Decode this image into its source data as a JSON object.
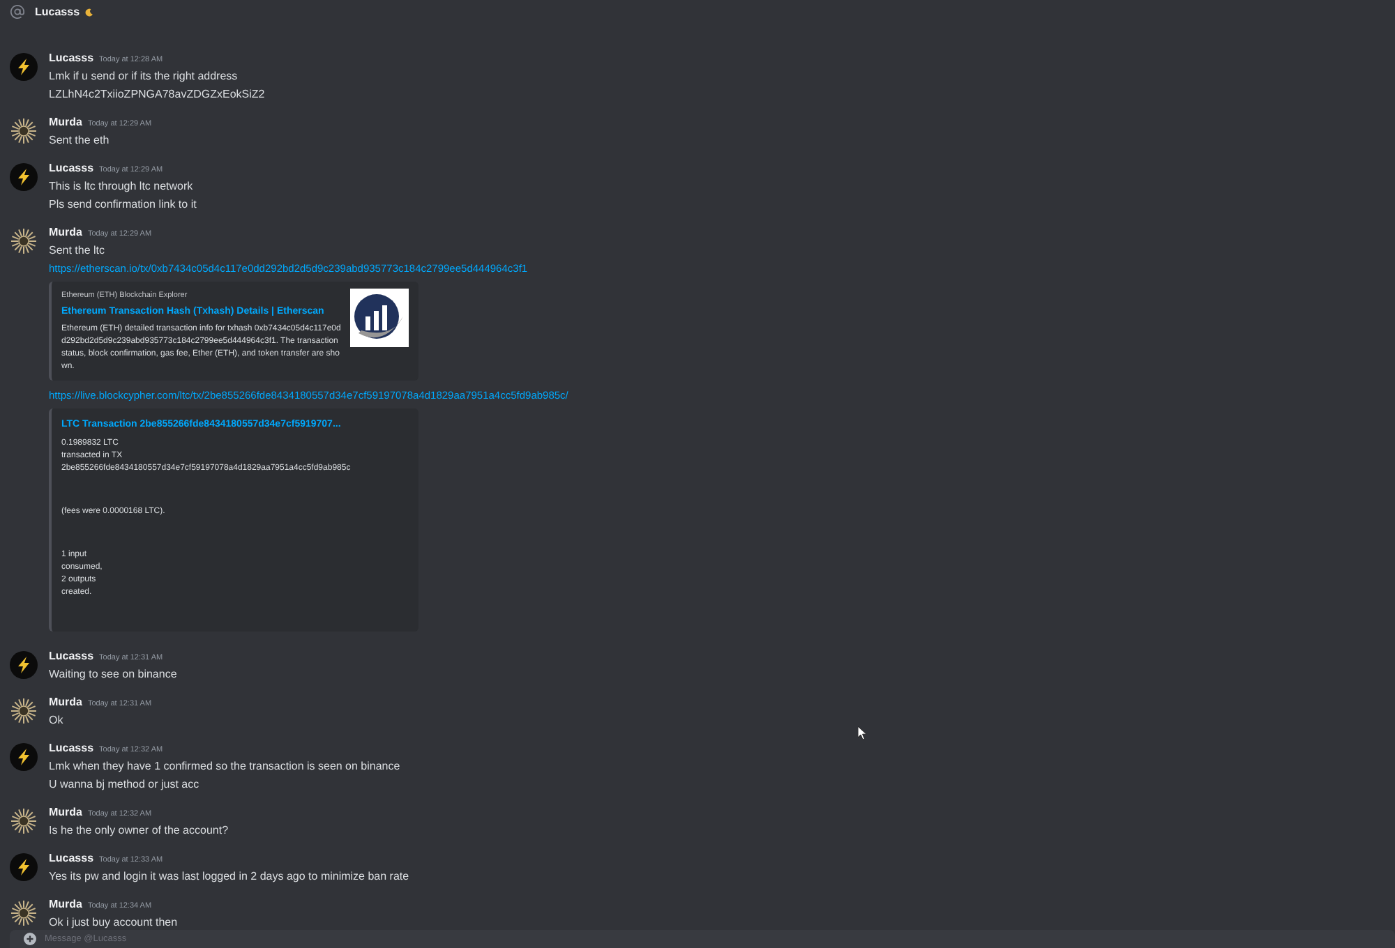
{
  "header": {
    "name": "Lucasss"
  },
  "messages": [
    {
      "author": "Lucasss",
      "kind": "bolt",
      "time": "Today at 12:28 AM",
      "lines": [
        {
          "kind": "text",
          "text": "Lmk if u send or if its the right address"
        },
        {
          "kind": "text",
          "text": "LZLhN4c2TxiioZPNGA78avZDGZxEokSiZ2"
        }
      ]
    },
    {
      "author": "Murda",
      "kind": "sunburst",
      "time": "Today at 12:29 AM",
      "lines": [
        {
          "kind": "text",
          "text": "Sent the eth"
        }
      ]
    },
    {
      "author": "Lucasss",
      "kind": "bolt",
      "time": "Today at 12:29 AM",
      "lines": [
        {
          "kind": "text",
          "text": "This is ltc through ltc network"
        },
        {
          "kind": "text",
          "text": "Pls send confirmation link to it"
        }
      ]
    },
    {
      "author": "Murda",
      "kind": "sunburst",
      "time": "Today at 12:29 AM",
      "lines": [
        {
          "kind": "text",
          "text": "Sent the ltc"
        },
        {
          "kind": "link",
          "text": "https://etherscan.io/tx/0xb7434c05d4c117e0dd292bd2d5d9c239abd935773c184c2799ee5d444964c3f1"
        },
        {
          "kind": "article",
          "provider": "Ethereum (ETH) Blockchain Explorer",
          "title": "Ethereum Transaction Hash (Txhash) Details | Etherscan",
          "description": "Ethereum (ETH) detailed transaction info for txhash 0xb7434c05d4c117e0dd292bd2d5d9c239abd935773c184c2799ee5d444964c3f1. The transaction status, block confirmation, gas fee, Ether (ETH), and token transfer are shown."
        },
        {
          "kind": "link",
          "text": "https://live.blockcypher.com/ltc/tx/2be855266fde8434180557d34e7cf59197078a4d1829aa7951a4cc5fd9ab985c/"
        },
        {
          "kind": "transaction",
          "title": "LTC Transaction 2be855266fde8434180557d34e7cf5919707...",
          "paragraphs": [
            "0.1989832 LTC\ntransacted in TX\n2be855266fde8434180557d34e7cf59197078a4d1829aa7951a4cc5fd9ab985c",
            "(fees were 0.0000168 LTC).",
            "1 input\nconsumed,\n2 outputs\ncreated."
          ]
        }
      ]
    },
    {
      "author": "Lucasss",
      "kind": "bolt",
      "time": "Today at 12:31 AM",
      "lines": [
        {
          "kind": "text",
          "text": "Waiting to see on binance"
        }
      ]
    },
    {
      "author": "Murda",
      "kind": "sunburst",
      "time": "Today at 12:31 AM",
      "lines": [
        {
          "kind": "text",
          "text": "Ok"
        }
      ]
    },
    {
      "author": "Lucasss",
      "kind": "bolt",
      "time": "Today at 12:32 AM",
      "lines": [
        {
          "kind": "text",
          "text": "Lmk when they have 1 confirmed so the transaction is seen on binance"
        },
        {
          "kind": "text",
          "text": "U wanna bj method or just acc"
        }
      ]
    },
    {
      "author": "Murda",
      "kind": "sunburst",
      "time": "Today at 12:32 AM",
      "lines": [
        {
          "kind": "text",
          "text": "Is he the only owner of the account?"
        }
      ]
    },
    {
      "author": "Lucasss",
      "kind": "bolt",
      "time": "Today at 12:33 AM",
      "lines": [
        {
          "kind": "text",
          "text": "Yes its pw and login it was last logged in 2 days ago to minimize ban rate"
        }
      ]
    },
    {
      "author": "Murda",
      "kind": "sunburst",
      "time": "Today at 12:34 AM",
      "lines": [
        {
          "kind": "text",
          "text": "Ok i just buy account then"
        }
      ]
    }
  ],
  "composer": {
    "placeholder": "Message @Lucasss"
  }
}
